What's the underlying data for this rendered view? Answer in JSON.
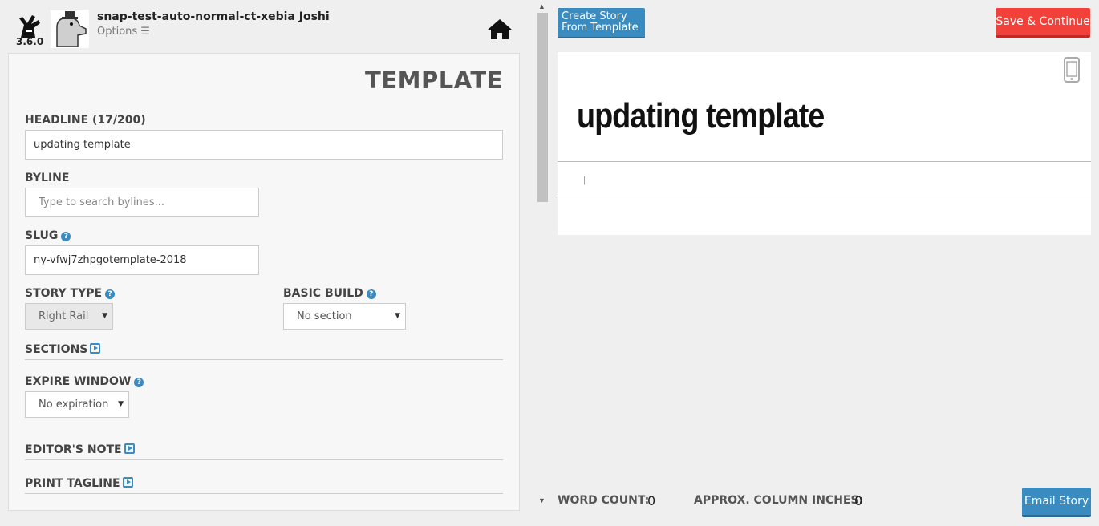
{
  "header": {
    "version": "3.6.0",
    "user_name": "snap-test-auto-normal-ct-xebia Joshi",
    "options_label": "Options ☰"
  },
  "form": {
    "title": "TEMPLATE",
    "headline_label": "HEADLINE (17/200)",
    "headline_value": "updating template",
    "byline_label": "BYLINE",
    "byline_placeholder": "Type to search bylines...",
    "slug_label": "SLUG",
    "slug_value": "ny-vfwj7zhpgotemplate-2018",
    "story_type_label": "STORY TYPE",
    "story_type_value": "Right Rail",
    "basic_build_label": "BASIC BUILD",
    "basic_build_value": "No section",
    "sections_label": "SECTIONS",
    "expire_window_label": "EXPIRE WINDOW",
    "expire_window_value": "No expiration",
    "editors_note_label": "EDITOR'S NOTE",
    "print_tagline_label": "PRINT TAGLINE"
  },
  "actions": {
    "create_from_template_label": "Create Story From Template",
    "save_continue_label": "Save & Continue",
    "email_story_label": "Email Story"
  },
  "preview": {
    "headline": "updating template",
    "byline": "|"
  },
  "footer": {
    "word_count_label": "WORD COUNT:",
    "word_count_value": "0",
    "column_inches_label": "APPROX. COLUMN INCHES:",
    "column_inches_value": "0"
  },
  "colors": {
    "accent_blue": "#3a8bbf",
    "save_red": "#f2413b"
  }
}
